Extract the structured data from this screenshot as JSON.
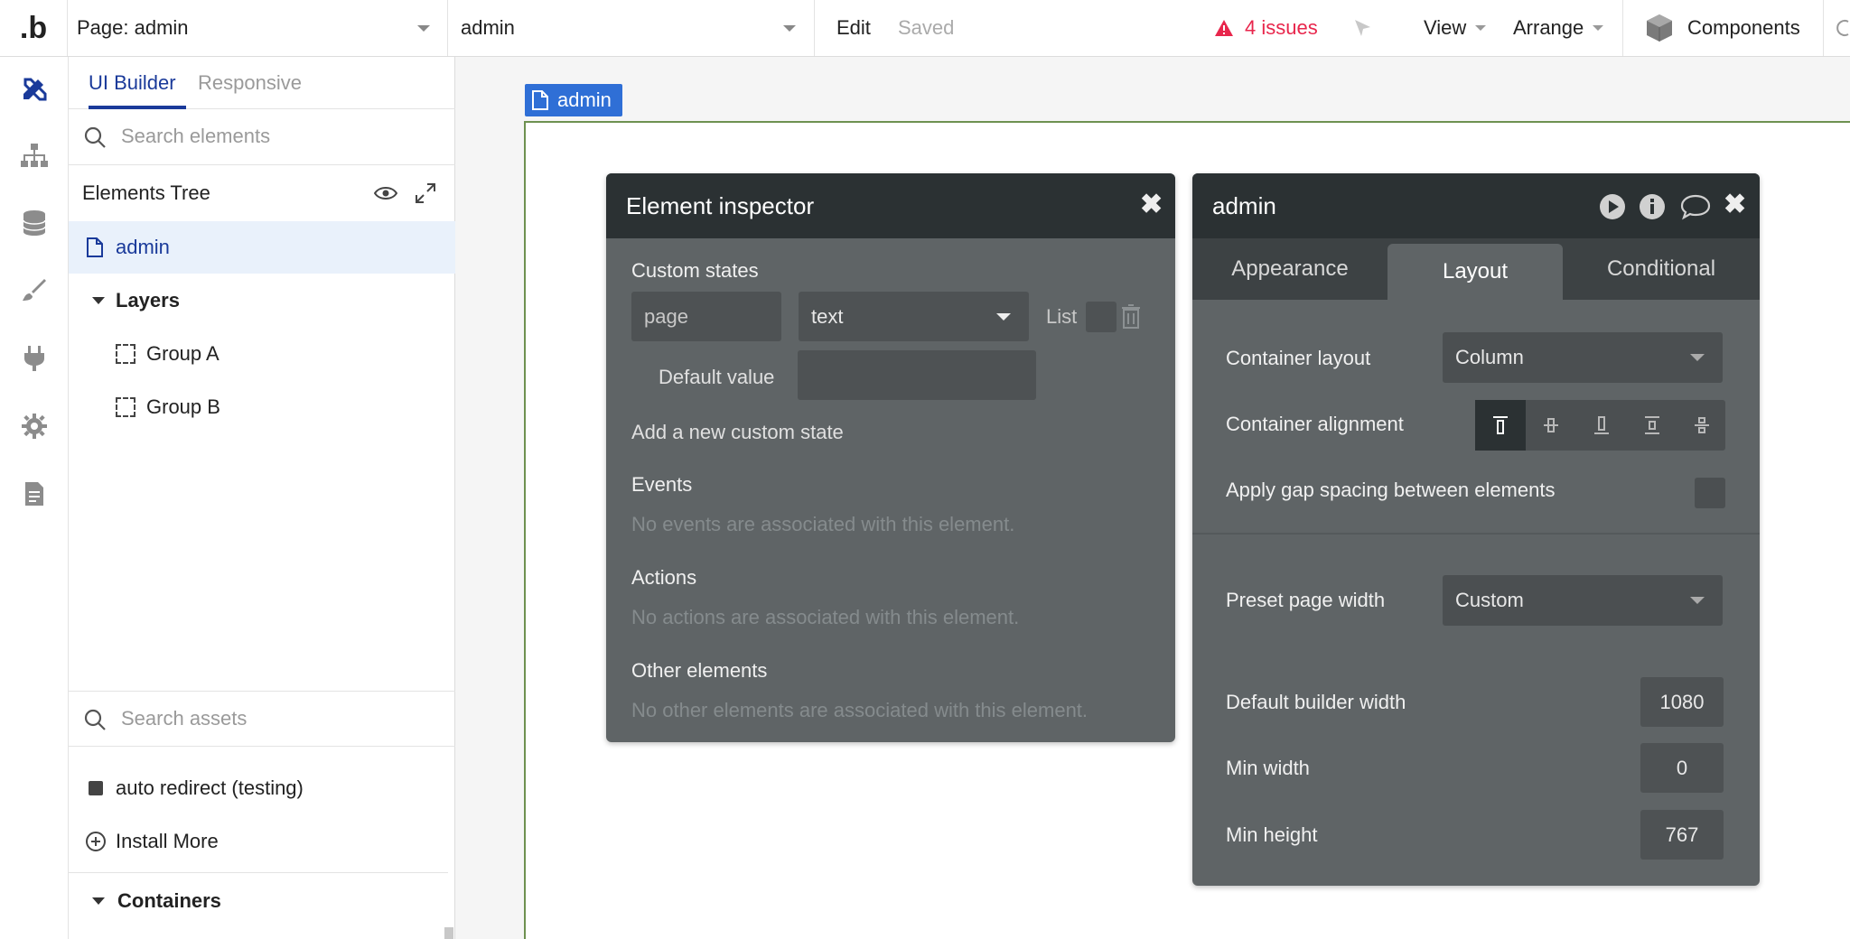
{
  "topbar": {
    "logo": ".b",
    "page_label": "Page: admin",
    "page_select": "admin",
    "edit": "Edit",
    "saved": "Saved",
    "issues": "4 issues",
    "view": "View",
    "arrange": "Arrange",
    "components": "Components",
    "issue_color": "#e8264c"
  },
  "left_panel": {
    "tabs": [
      "UI Builder",
      "Responsive"
    ],
    "search_elements_placeholder": "Search elements",
    "tree_title": "Elements Tree",
    "tree_items": {
      "page": "admin",
      "layers": "Layers",
      "group_a": "Group A",
      "group_b": "Group B"
    },
    "search_assets_placeholder": "Search assets",
    "plugins": {
      "auto_redirect": "auto redirect (testing)",
      "install_more": "Install More"
    },
    "containers": "Containers"
  },
  "canvas": {
    "page_badge": "admin"
  },
  "element_inspector": {
    "title": "Element inspector",
    "custom_states_label": "Custom states",
    "state_name": "page",
    "state_type": "text",
    "list_label": "List",
    "default_value_label": "Default value",
    "add_state": "Add a new custom state",
    "events_label": "Events",
    "events_empty": "No events are associated with this element.",
    "actions_label": "Actions",
    "actions_empty": "No actions are associated with this element.",
    "other_label": "Other elements",
    "other_empty": "No other elements are associated with this element."
  },
  "property_editor": {
    "title": "admin",
    "tabs": [
      "Appearance",
      "Layout",
      "Conditional"
    ],
    "container_layout_label": "Container layout",
    "container_layout_value": "Column",
    "container_alignment_label": "Container alignment",
    "gap_label": "Apply gap spacing between elements",
    "preset_width_label": "Preset page width",
    "preset_width_value": "Custom",
    "builder_width_label": "Default builder width",
    "builder_width_value": "1080",
    "min_width_label": "Min width",
    "min_width_value": "0",
    "min_height_label": "Min height",
    "min_height_value": "767"
  }
}
